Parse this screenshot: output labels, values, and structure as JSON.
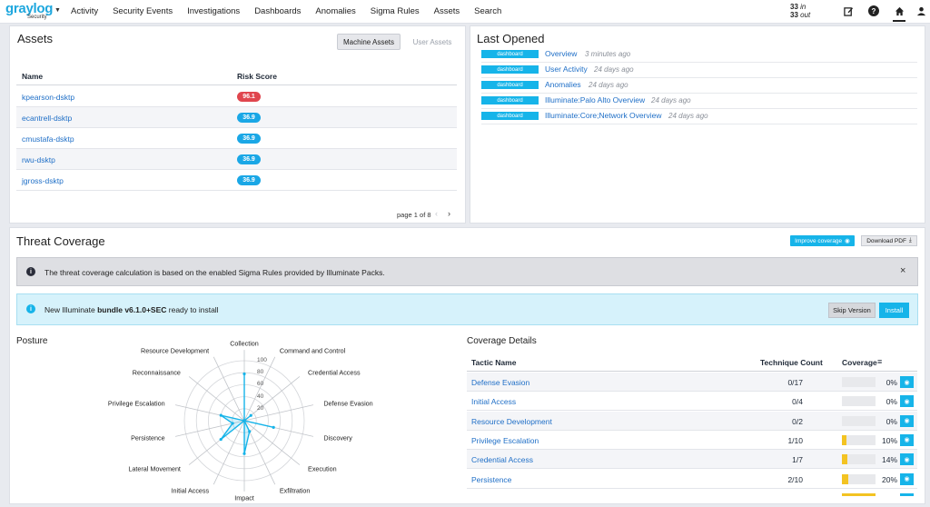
{
  "nav": {
    "logo": "graylog",
    "logo_sub": "Security",
    "items": [
      "Activity",
      "Security Events",
      "Investigations",
      "Dashboards",
      "Anomalies",
      "Sigma Rules",
      "Assets",
      "Search"
    ],
    "throughput_in_value": "33",
    "throughput_in_label": "in",
    "throughput_out_value": "33",
    "throughput_out_label": "out",
    "icons": [
      "edit-icon",
      "help-icon",
      "home-icon",
      "user-icon"
    ]
  },
  "assets": {
    "title": "Assets",
    "tab_machine": "Machine Assets",
    "tab_user": "User Assets",
    "col_name": "Name",
    "col_risk": "Risk Score",
    "rows": [
      {
        "name": "kpearson-dsktp",
        "score": "96.1",
        "level": "high"
      },
      {
        "name": "ecantrell-dsktp",
        "score": "36.9",
        "level": "normal"
      },
      {
        "name": "cmustafa-dsktp",
        "score": "36.9",
        "level": "normal"
      },
      {
        "name": "rwu-dsktp",
        "score": "36.9",
        "level": "normal"
      },
      {
        "name": "jgross-dsktp",
        "score": "36.9",
        "level": "normal"
      }
    ],
    "pagination": "page 1 of 8"
  },
  "last_opened": {
    "title": "Last Opened",
    "items": [
      {
        "tag": "dashboard",
        "name": "Overview",
        "time": "3 minutes ago"
      },
      {
        "tag": "dashboard",
        "name": "User Activity",
        "time": "24 days ago"
      },
      {
        "tag": "dashboard",
        "name": "Anomalies",
        "time": "24 days ago"
      },
      {
        "tag": "dashboard",
        "name": "Illuminate:Palo Alto Overview",
        "time": "24 days ago"
      },
      {
        "tag": "dashboard",
        "name": "Illuminate:Core;Network Overview",
        "time": "24 days ago"
      }
    ]
  },
  "threat": {
    "title": "Threat Coverage",
    "improve_label": "Improve coverage",
    "pdf_label": "Download PDF",
    "info_text": "The threat coverage calculation is based on the enabled Sigma Rules provided by Illuminate Packs.",
    "bundle_prefix": "New Illuminate ",
    "bundle_name": "bundle v6.1.0+SEC",
    "bundle_suffix": " ready to install",
    "skip_label": "Skip Version",
    "install_label": "Install",
    "posture_title": "Posture",
    "details_title": "Coverage Details",
    "col_tactic": "Tactic Name",
    "col_count": "Technique Count",
    "col_coverage": "Coverage",
    "rows": [
      {
        "tactic": "Defense Evasion",
        "count": "0/17",
        "pct": "0%",
        "value": 0
      },
      {
        "tactic": "Initial Access",
        "count": "0/4",
        "pct": "0%",
        "value": 0
      },
      {
        "tactic": "Resource Development",
        "count": "0/2",
        "pct": "0%",
        "value": 0
      },
      {
        "tactic": "Privilege Escalation",
        "count": "1/10",
        "pct": "10%",
        "value": 0.1
      },
      {
        "tactic": "Credential Access",
        "count": "1/7",
        "pct": "14%",
        "value": 0.14
      },
      {
        "tactic": "Persistence",
        "count": "2/10",
        "pct": "20%",
        "value": 0.2
      }
    ],
    "accent": "#16b4e9",
    "bar_color": "#f3c322"
  },
  "chart_data": {
    "type": "radar",
    "categories": [
      "Collection",
      "Command and Control",
      "Credential Access",
      "Defense Evasion",
      "Discovery",
      "Execution",
      "Exfiltration",
      "Impact",
      "Initial Access",
      "Lateral Movement",
      "Persistence",
      "Privilege Escalation",
      "Reconnaissance",
      "Resource Development"
    ],
    "values": [
      78,
      0,
      14,
      0,
      50,
      0,
      20,
      55,
      0,
      50,
      20,
      40,
      0,
      0
    ],
    "ticks": [
      "0",
      "20",
      "40",
      "60",
      "80",
      "100"
    ],
    "rlim": [
      0,
      100
    ],
    "color": "#16b4e9"
  }
}
